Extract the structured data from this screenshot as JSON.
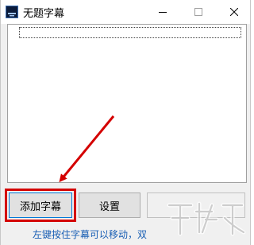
{
  "window": {
    "title": "无题字幕"
  },
  "buttons": {
    "add_subtitle": "添加字幕",
    "settings": "设置",
    "third": ""
  },
  "status": {
    "text": "左键按住字幕可以移动，双"
  },
  "colors": {
    "highlight": "#d40000",
    "arrow": "#d40000",
    "status_text": "#1a5fb4"
  }
}
